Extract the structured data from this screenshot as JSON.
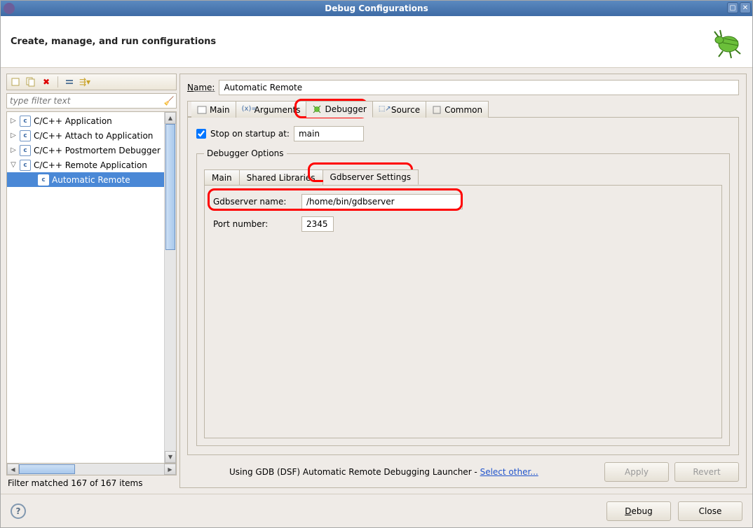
{
  "window": {
    "title": "Debug Configurations"
  },
  "header": {
    "title": "Create, manage, and run configurations"
  },
  "toolbar": {
    "filter_placeholder": "type filter text"
  },
  "tree": {
    "items": [
      {
        "label": "C/C++ Application",
        "expanded": false
      },
      {
        "label": "C/C++ Attach to Application",
        "expanded": false
      },
      {
        "label": "C/C++ Postmortem Debugger",
        "expanded": false
      },
      {
        "label": "C/C++ Remote Application",
        "expanded": true,
        "children": [
          {
            "label": "Automatic Remote",
            "selected": true
          }
        ]
      }
    ],
    "filter_status": "Filter matched 167 of 167 items"
  },
  "form": {
    "name_label": "Name:",
    "name_value": "Automatic Remote",
    "tabs": {
      "main": "Main",
      "arguments": "Arguments",
      "debugger": "Debugger",
      "source": "Source",
      "common": "Common"
    },
    "stop_label": "Stop on startup at:",
    "stop_value": "main",
    "dopts_legend": "Debugger Options",
    "subtabs": {
      "main": "Main",
      "shared": "Shared Libraries",
      "gdbserver": "Gdbserver Settings"
    },
    "gdbserver_name_label": "Gdbserver name:",
    "gdbserver_name_value": "/home/bin/gdbserver",
    "port_label": "Port number:",
    "port_value": "2345",
    "launcher_text": "Using GDB (DSF) Automatic Remote Debugging Launcher - ",
    "launcher_link": "Select other...",
    "apply": "Apply",
    "revert": "Revert"
  },
  "footer": {
    "debug": "Debug",
    "close": "Close"
  }
}
